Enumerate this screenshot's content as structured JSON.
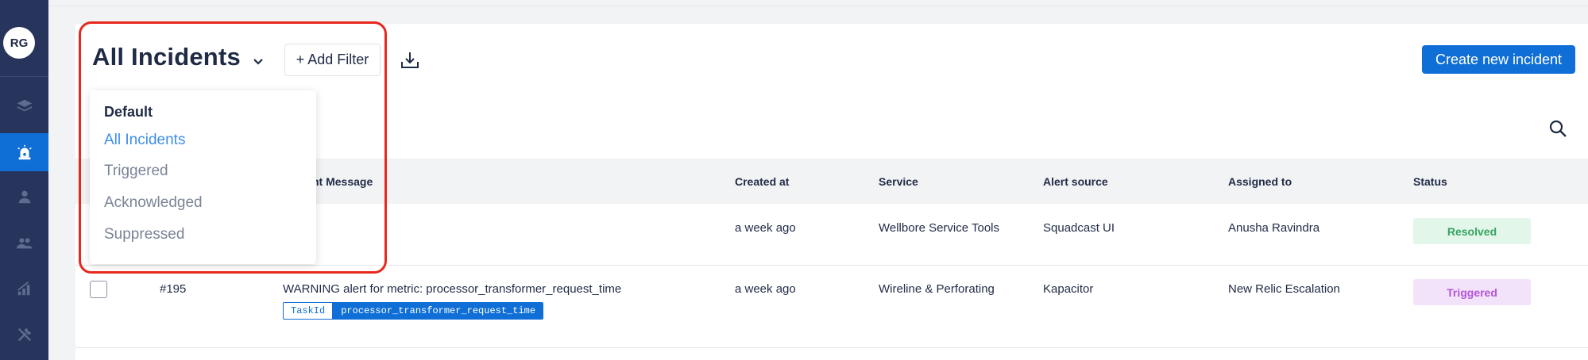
{
  "sidebar": {
    "avatar_initials": "RG",
    "items": [
      {
        "icon": "layers-icon"
      },
      {
        "icon": "siren-icon",
        "active": true
      },
      {
        "icon": "user-icon"
      },
      {
        "icon": "users-icon"
      },
      {
        "icon": "bar-chart-icon"
      },
      {
        "icon": "tools-icon"
      }
    ]
  },
  "header": {
    "title": "All Incidents",
    "add_filter_label": "+ Add Filter",
    "create_label": "Create new incident"
  },
  "dropdown": {
    "group_label": "Default",
    "options": [
      "All Incidents",
      "Triggered",
      "Acknowledged",
      "Suppressed"
    ],
    "selected": "All Incidents"
  },
  "table": {
    "headers": {
      "message": "nt Message",
      "created_at": "Created at",
      "service": "Service",
      "alert_source": "Alert source",
      "assigned_to": "Assigned to",
      "status": "Status"
    },
    "rows": [
      {
        "created_at": "a week ago",
        "service": "Wellbore Service Tools",
        "alert_source": "Squadcast UI",
        "assigned_to": "Anusha Ravindra",
        "status": "Resolved"
      },
      {
        "id": "#195",
        "message": "WARNING alert for metric: processor_transformer_request_time",
        "tag_key": "TaskId",
        "tag_value": "processor_transformer_request_time",
        "created_at": "a week ago",
        "service": "Wireline & Perforating",
        "alert_source": "Kapacitor",
        "assigned_to": "New Relic Escalation",
        "status": "Triggered"
      }
    ]
  },
  "colors": {
    "sidebar_bg": "#27355c",
    "accent": "#0f6fd6",
    "resolved": "#35a45f",
    "triggered": "#b356d8",
    "highlight": "#e8271e"
  }
}
